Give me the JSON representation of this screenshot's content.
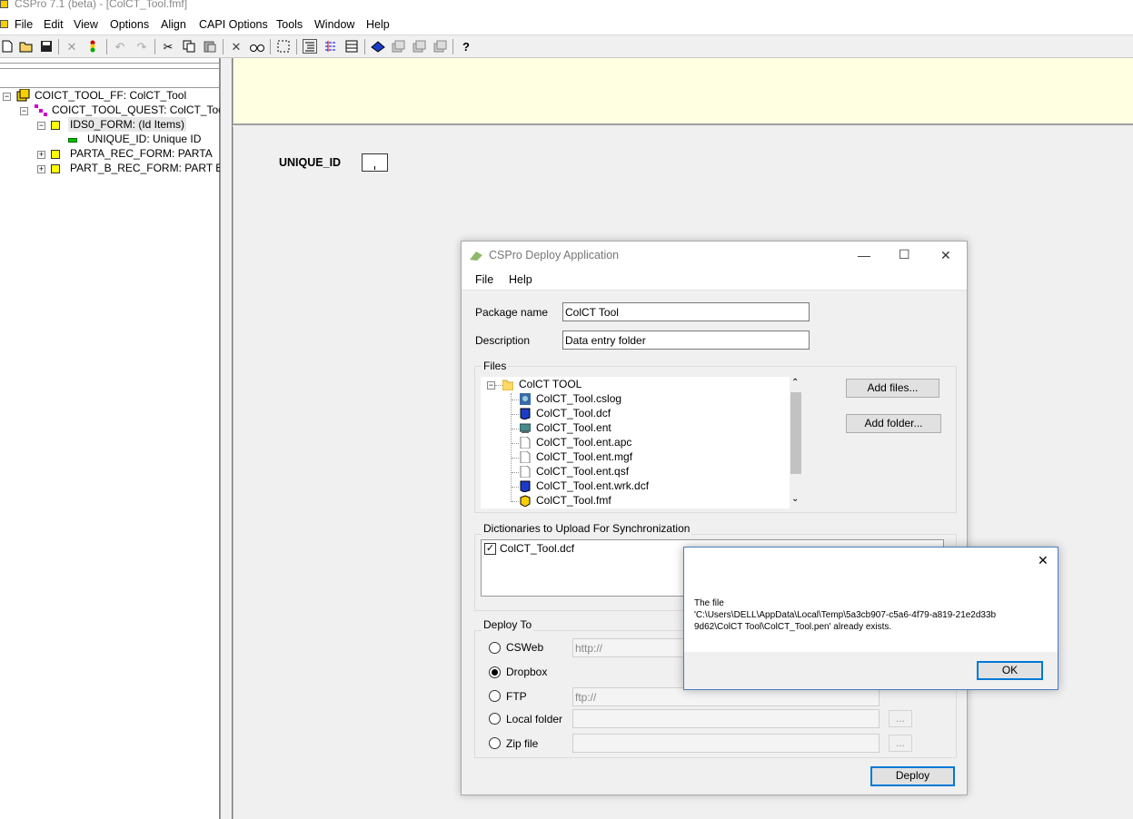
{
  "app": {
    "title": "CSPro 7.1 (beta) - [ColCT_Tool.fmf]",
    "menus": [
      "File",
      "Edit",
      "View",
      "Options",
      "Align",
      "CAPI Options",
      "Tools",
      "Window",
      "Help"
    ]
  },
  "toolbar": {
    "icons": [
      "new-icon",
      "open-icon",
      "save-icon",
      "generate-icon",
      "run-icon",
      "undo-icon",
      "redo-icon",
      "cut-icon",
      "copy-icon",
      "paste-icon",
      "delete-icon",
      "find-icon",
      "select-icon",
      "tree-icon",
      "order-icon",
      "grid-icon",
      "dictionary-icon",
      "form-icon",
      "form2-icon",
      "form3-icon",
      "help-icon"
    ]
  },
  "tree": {
    "items": [
      {
        "label": "COICT_TOOL_FF: ColCT_Tool"
      },
      {
        "label": "COICT_TOOL_QUEST: ColCT_Tool q"
      },
      {
        "label": "IDS0_FORM: (Id Items)"
      },
      {
        "label": "UNIQUE_ID: Unique ID"
      },
      {
        "label": "PARTA_REC_FORM: PARTA"
      },
      {
        "label": "PART_B_REC_FORM: PART B"
      }
    ]
  },
  "form": {
    "field_label": "UNIQUE_ID"
  },
  "deploy": {
    "title": "CSPro Deploy Application",
    "menus": [
      "File",
      "Help"
    ],
    "package_name_label": "Package name",
    "package_name_value": "ColCT Tool",
    "description_label": "Description",
    "description_value": "Data entry folder",
    "files_label": "Files",
    "root_folder": "ColCT TOOL",
    "files": [
      "ColCT_Tool.cslog",
      "ColCT_Tool.dcf",
      "ColCT_Tool.ent",
      "ColCT_Tool.ent.apc",
      "ColCT_Tool.ent.mgf",
      "ColCT_Tool.ent.qsf",
      "ColCT_Tool.ent.wrk.dcf",
      "ColCT_Tool.fmf"
    ],
    "add_files_label": "Add files...",
    "add_folder_label": "Add folder...",
    "dicts_label": "Dictionaries to Upload For Synchronization",
    "dict_item": "ColCT_Tool.dcf",
    "deploy_to_label": "Deploy To",
    "options": [
      {
        "label": "CSWeb",
        "placeholder": "http://"
      },
      {
        "label": "Dropbox",
        "placeholder": ""
      },
      {
        "label": "FTP",
        "placeholder": "ftp://"
      },
      {
        "label": "Local folder",
        "placeholder": ""
      },
      {
        "label": "Zip file",
        "placeholder": ""
      }
    ],
    "selected_option": "Dropbox",
    "browse_label": "...",
    "deploy_button": "Deploy"
  },
  "message": {
    "text": "The file\n'C:\\Users\\DELL\\AppData\\Local\\Temp\\5a3cb907-c5a6-4f79-a819-21e2d33b\n9d62\\ColCT Tool\\ColCT_Tool.pen' already exists.",
    "ok_label": "OK"
  }
}
